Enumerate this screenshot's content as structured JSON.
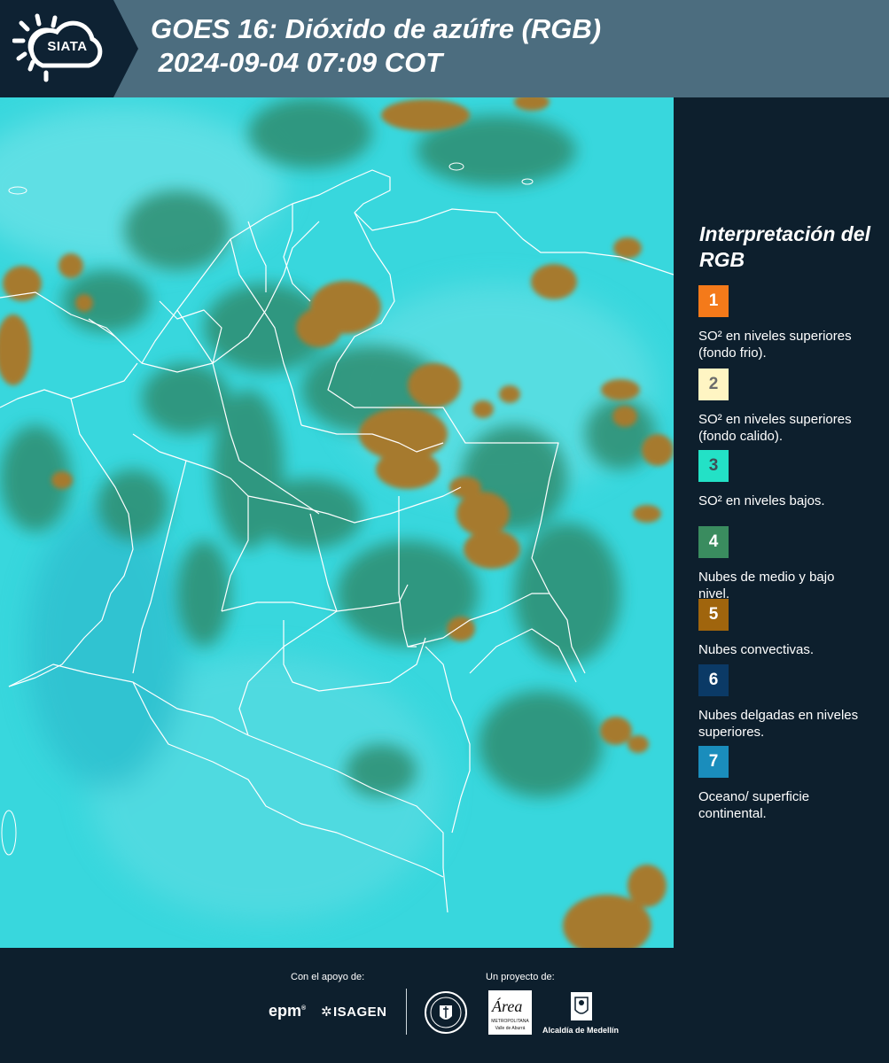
{
  "header": {
    "logo_text": "SIATA",
    "title_line1": "GOES 16: Dióxido de azúfre (RGB)",
    "title_line2": " 2024-09-04 07:09 COT"
  },
  "legend": {
    "title": "Interpretación del RGB",
    "items": [
      {
        "number": "1",
        "text": "SO² en niveles superiores (fondo frio).",
        "color": "#f47a1a",
        "number_color": "#ffffff"
      },
      {
        "number": "2",
        "text": "SO² en niveles superiores (fondo calido).",
        "color": "#fff5c3",
        "number_color": "#6b6b6b"
      },
      {
        "number": "3",
        "text": "SO² en niveles bajos.",
        "color": "#23e1c6",
        "number_color": "#3f4f55"
      },
      {
        "number": "4",
        "text": "Nubes de medio y bajo nivel.",
        "color": "#3a8c5f",
        "number_color": "#ffffff"
      },
      {
        "number": "5",
        "text": "Nubes convectivas.",
        "color": "#a0650d",
        "number_color": "#ffffff"
      },
      {
        "number": "6",
        "text": "Nubes delgadas en niveles superiores.",
        "color": "#0b3a66",
        "number_color": "#ffffff"
      },
      {
        "number": "7",
        "text": "Oceano/ superficie continental.",
        "color": "#1a8dbc",
        "number_color": "#ffffff"
      }
    ]
  },
  "footer": {
    "support_label": "Con el apoyo de:",
    "project_label": "Un proyecto de:",
    "epm": "epm",
    "isagen": "ISAGEN",
    "area_name": "Área",
    "area_sub1": "METROPOLITANA",
    "area_sub2": "Valle de Aburrá",
    "alcaldia": "Alcaldía de Medellín"
  },
  "colors": {
    "map_background": "#38d7dd",
    "cloud_green": "#2f8d70",
    "convective": "#a67a2e"
  }
}
